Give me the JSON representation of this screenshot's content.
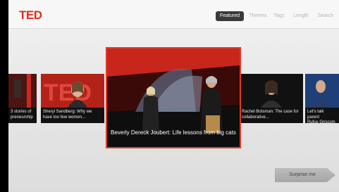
{
  "app": {
    "logo": "TED"
  },
  "nav": {
    "tabs": [
      {
        "label": "Featured",
        "active": true
      },
      {
        "label": "Themes"
      },
      {
        "label": "Tags"
      },
      {
        "label": "Length"
      },
      {
        "label": "Search"
      }
    ]
  },
  "carousel": {
    "items": [
      {
        "caption": "3 stories of\npreneurship"
      },
      {
        "caption": "Sheryl Sandberg: Why we have too few women..."
      },
      {
        "caption": "Rachel Botsman: The case for collaborative..."
      },
      {
        "caption": "Let's talk parent\nRufus Griscom"
      }
    ],
    "featured": {
      "caption": "Beverly   Dereck Joubert: Life lessons from big cats"
    }
  },
  "actions": {
    "surprise_label": "Surprise me"
  },
  "colors": {
    "accent": "#e62b1e",
    "featured_border": "#e0392b"
  }
}
